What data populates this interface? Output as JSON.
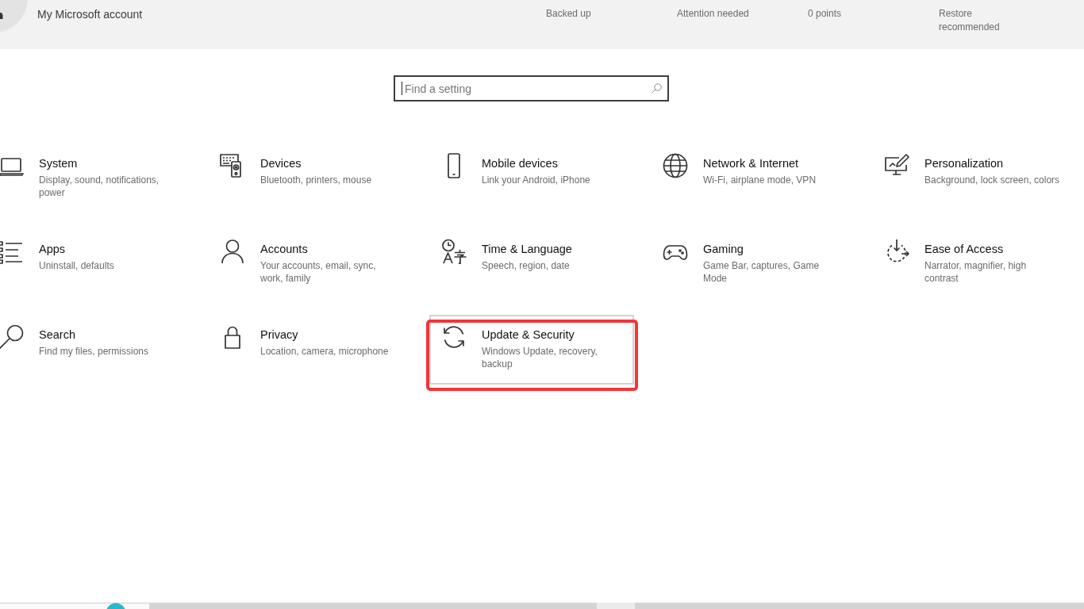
{
  "account": {
    "label": "My Microsoft account"
  },
  "status_items": [
    "Backed up",
    "Attention needed",
    "0 points",
    "Restore recommended"
  ],
  "search": {
    "placeholder": "Find a setting",
    "focused": true
  },
  "categories": [
    {
      "title": "System",
      "description": "Display, sound, notifications, power",
      "selected": false,
      "annotated": false
    },
    {
      "title": "Devices",
      "description": "Bluetooth, printers, mouse",
      "selected": false,
      "annotated": false
    },
    {
      "title": "Mobile devices",
      "description": "Link your Android, iPhone",
      "selected": false,
      "annotated": false
    },
    {
      "title": "Network & Internet",
      "description": "Wi-Fi, airplane mode, VPN",
      "selected": false,
      "annotated": false
    },
    {
      "title": "Personalization",
      "description": "Background, lock screen, colors",
      "selected": false,
      "annotated": false
    },
    {
      "title": "Apps",
      "description": "Uninstall, defaults",
      "selected": false,
      "annotated": false
    },
    {
      "title": "Accounts",
      "description": "Your accounts, email, sync, work, family",
      "selected": false,
      "annotated": false
    },
    {
      "title": "Time & Language",
      "description": "Speech, region, date",
      "selected": false,
      "annotated": false
    },
    {
      "title": "Gaming",
      "description": "Game Bar, captures, Game Mode",
      "selected": false,
      "annotated": false
    },
    {
      "title": "Ease of Access",
      "description": "Narrator, magnifier, high contrast",
      "selected": false,
      "annotated": false
    },
    {
      "title": "Search",
      "description": "Find my files, permissions",
      "selected": false,
      "annotated": false
    },
    {
      "title": "Privacy",
      "description": "Location, camera, microphone",
      "selected": false,
      "annotated": false
    },
    {
      "title": "Update & Security",
      "description": "Windows Update, recovery, backup",
      "selected": true,
      "annotated": true
    }
  ]
}
